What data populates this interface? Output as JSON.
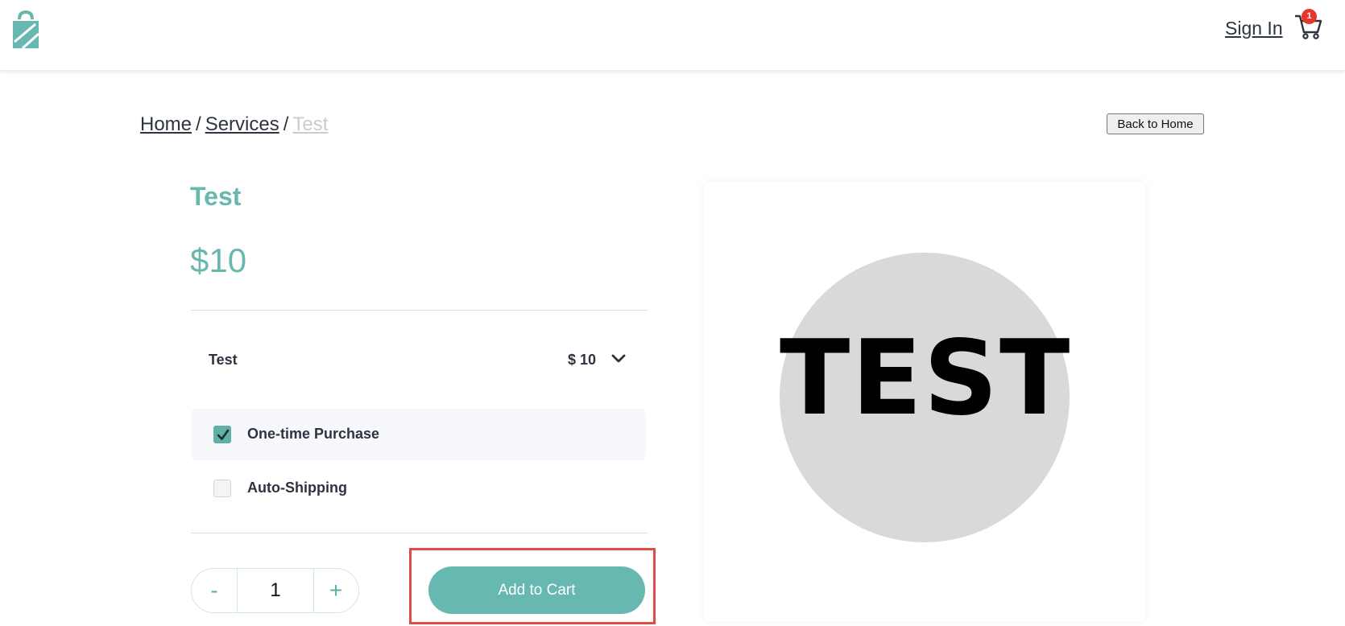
{
  "header": {
    "logo": "shopping-bag-logo",
    "sign_in_label": "Sign In",
    "cart_count": "1"
  },
  "breadcrumb": {
    "home": "Home",
    "separator": "/",
    "services": "Services",
    "current": "Test"
  },
  "back_button_label": "Back to Home",
  "product": {
    "title": "Test",
    "price": "$10",
    "variant": {
      "name": "Test",
      "price": "$ 10"
    },
    "purchase_options": [
      {
        "label": "One-time Purchase",
        "checked": true
      },
      {
        "label": "Auto-Shipping",
        "checked": false
      }
    ],
    "quantity": "1",
    "minus_label": "-",
    "plus_label": "+",
    "add_to_cart_label": "Add to Cart",
    "image_text": "TEST"
  },
  "colors": {
    "accent": "#67b8b0",
    "badge": "#e8352c",
    "highlight": "#e04b45"
  }
}
